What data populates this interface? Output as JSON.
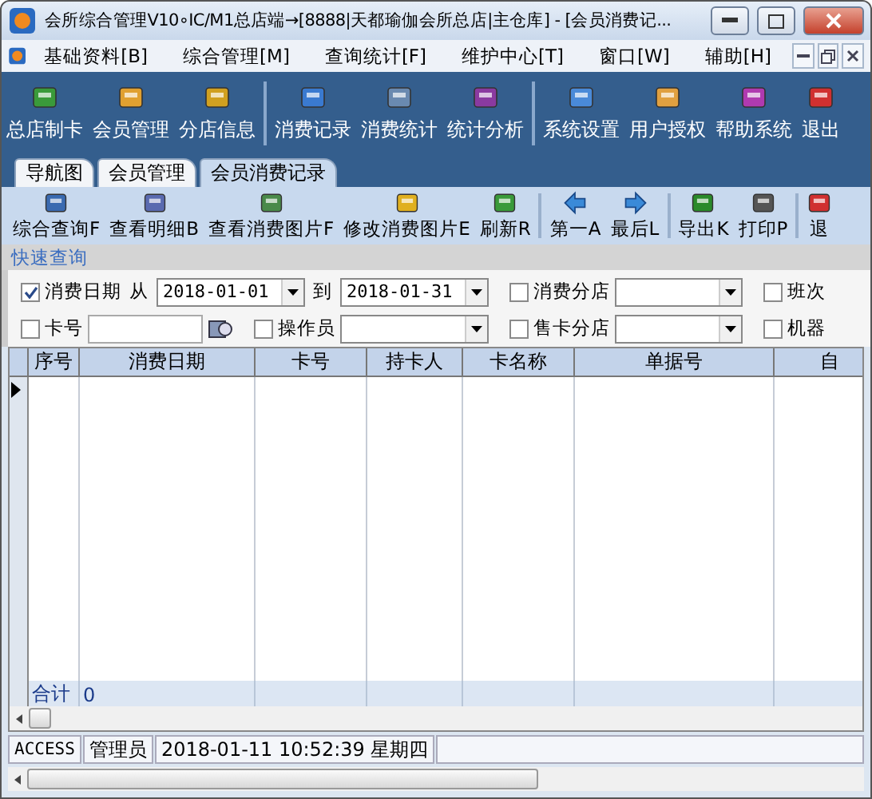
{
  "window": {
    "title": "会所综合管理V10∘IC/M1总店端→[8888|天都瑜伽会所总店|主仓库] - [会员消费记..."
  },
  "menu": [
    "基础资料[B]",
    "综合管理[M]",
    "查询统计[F]",
    "维护中心[T]",
    "窗口[W]",
    "辅助[H]"
  ],
  "toolbar": [
    [
      {
        "label": "总店制卡"
      },
      {
        "label": "会员管理"
      },
      {
        "label": "分店信息"
      }
    ],
    [
      {
        "label": "消费记录"
      },
      {
        "label": "消费统计"
      },
      {
        "label": "统计分析"
      }
    ],
    [
      {
        "label": "系统设置"
      },
      {
        "label": "用户授权"
      },
      {
        "label": "帮助系统"
      },
      {
        "label": "退出"
      }
    ]
  ],
  "tabs": [
    {
      "label": "导航图",
      "selected": false
    },
    {
      "label": "会员管理",
      "selected": false
    },
    {
      "label": "会员消费记录",
      "selected": true
    }
  ],
  "actions": [
    [
      {
        "label": "综合查询F"
      },
      {
        "label": "查看明细B"
      },
      {
        "label": "查看消费图片F"
      },
      {
        "label": "修改消费图片E"
      },
      {
        "label": "刷新R"
      }
    ],
    [
      {
        "label": "第一A"
      },
      {
        "label": "最后L"
      }
    ],
    [
      {
        "label": "导出K"
      },
      {
        "label": "打印P"
      }
    ],
    [
      {
        "label": "退"
      }
    ]
  ],
  "quick_query": "快速查询",
  "filters": [
    [
      {
        "kind": "check",
        "label": "消费日期",
        "checked": true
      },
      {
        "kind": "text",
        "label": "从"
      },
      {
        "kind": "combo",
        "value": "2018-01-01"
      },
      {
        "kind": "text",
        "label": "到"
      },
      {
        "kind": "combo",
        "value": "2018-01-31"
      },
      {
        "kind": "check",
        "label": "消费分店",
        "checked": false
      },
      {
        "kind": "combo"
      },
      {
        "kind": "check",
        "label": "班次",
        "checked": false
      }
    ],
    [
      {
        "kind": "check",
        "label": "卡号",
        "checked": false
      },
      {
        "kind": "field"
      },
      {
        "kind": "lookup"
      },
      {
        "kind": "check",
        "label": "操作员",
        "checked": false
      },
      {
        "kind": "combo"
      },
      {
        "kind": "check",
        "label": "售卡分店",
        "checked": false
      },
      {
        "kind": "combo"
      },
      {
        "kind": "check",
        "label": "机器",
        "checked": false
      }
    ]
  ],
  "table": {
    "columns": [
      "序号",
      "消费日期",
      "卡号",
      "持卡人",
      "卡名称",
      "单据号",
      "自"
    ],
    "total": {
      "label": "合计",
      "value": "0"
    }
  },
  "status_bar": [
    "ACCESS",
    "管理员",
    "2018-01-11 10:52:39 星期四"
  ]
}
